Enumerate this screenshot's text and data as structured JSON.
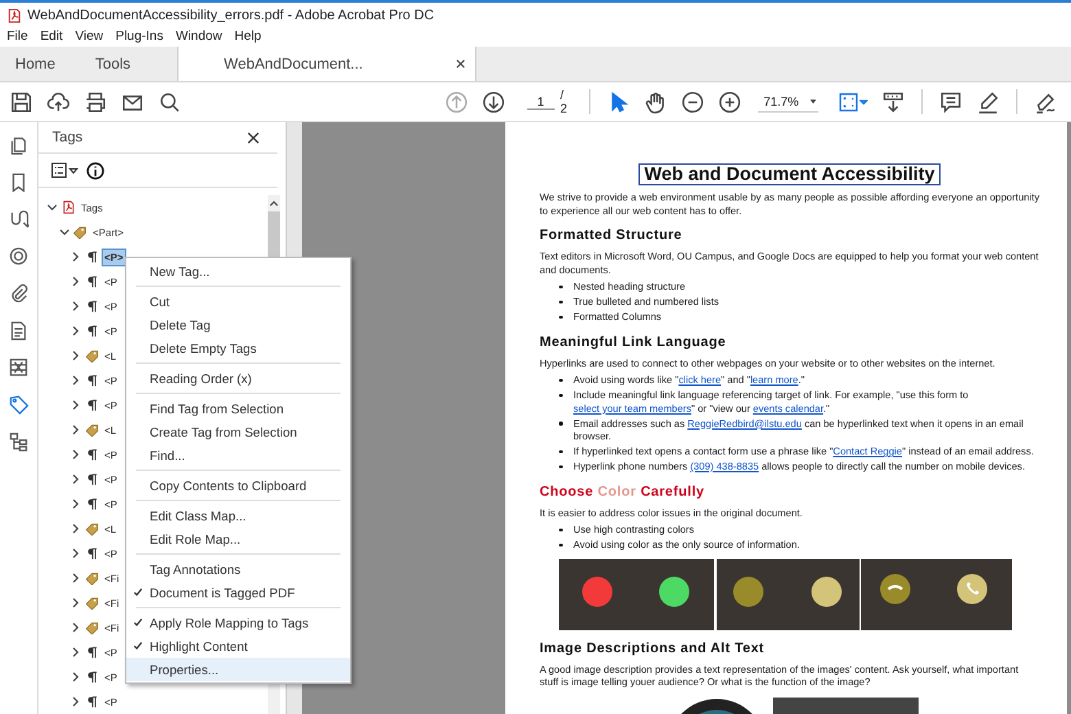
{
  "window": {
    "title": "WebAndDocumentAccessibility_errors.pdf - Adobe Acrobat Pro DC"
  },
  "menu": [
    "File",
    "Edit",
    "View",
    "Plug-Ins",
    "Window",
    "Help"
  ],
  "tabs": [
    {
      "label": "Home",
      "selected": false
    },
    {
      "label": "Tools",
      "selected": false
    },
    {
      "label": "WebAndDocument...",
      "selected": true
    }
  ],
  "toolbar": {
    "nav": [
      {
        "kind": "up",
        "disabled": true
      },
      {
        "kind": "down",
        "disabled": false
      }
    ],
    "page": "1",
    "page_total": "/ 2",
    "tools": [
      {
        "kind": "pointer",
        "selected": true
      },
      {
        "kind": "hand",
        "selected": false
      }
    ],
    "zoom": "71.7%"
  },
  "rail": [
    {
      "kind": "pages",
      "selected": false
    },
    {
      "kind": "bookmarks",
      "selected": false
    },
    {
      "kind": "hook",
      "selected": false
    },
    {
      "kind": "target",
      "selected": false
    },
    {
      "kind": "attachments",
      "selected": false
    },
    {
      "kind": "document",
      "selected": false
    },
    {
      "kind": "compare",
      "selected": false
    },
    {
      "kind": "tags",
      "selected": true
    },
    {
      "kind": "tree",
      "selected": false
    }
  ],
  "tags_panel": {
    "title": "Tags",
    "tree": [
      {
        "label": "Tags",
        "kind": "root",
        "expanded": true,
        "selected": false,
        "children": [
          {
            "label": "<Part>",
            "kind": "tag",
            "expanded": true,
            "selected": false,
            "children": [
              {
                "label": "<P>",
                "kind": "para",
                "expanded": false,
                "selected": true
              },
              {
                "label": "<P",
                "kind": "para",
                "expanded": false,
                "selected": false
              },
              {
                "label": "<P",
                "kind": "para",
                "expanded": false,
                "selected": false
              },
              {
                "label": "<P",
                "kind": "para",
                "expanded": false,
                "selected": false
              },
              {
                "label": "<L",
                "kind": "tag",
                "expanded": false,
                "selected": false
              },
              {
                "label": "<P",
                "kind": "para",
                "expanded": false,
                "selected": false
              },
              {
                "label": "<P",
                "kind": "para",
                "expanded": false,
                "selected": false
              },
              {
                "label": "<L",
                "kind": "tag",
                "expanded": false,
                "selected": false
              },
              {
                "label": "<P",
                "kind": "para",
                "expanded": false,
                "selected": false
              },
              {
                "label": "<P",
                "kind": "para",
                "expanded": false,
                "selected": false
              },
              {
                "label": "<P",
                "kind": "para",
                "expanded": false,
                "selected": false
              },
              {
                "label": "<L",
                "kind": "tag",
                "expanded": false,
                "selected": false
              },
              {
                "label": "<P",
                "kind": "para",
                "expanded": false,
                "selected": false
              },
              {
                "label": "<Fi",
                "kind": "tag",
                "expanded": false,
                "selected": false
              },
              {
                "label": "<Fi",
                "kind": "tag",
                "expanded": false,
                "selected": false
              },
              {
                "label": "<Fi",
                "kind": "tag",
                "expanded": false,
                "selected": false
              },
              {
                "label": "<P",
                "kind": "para",
                "expanded": false,
                "selected": false
              },
              {
                "label": "<P",
                "kind": "para",
                "expanded": false,
                "selected": false
              },
              {
                "label": "<P",
                "kind": "para",
                "expanded": false,
                "selected": false
              }
            ]
          }
        ]
      }
    ]
  },
  "context_menu": [
    {
      "kind": "item",
      "label": "New Tag...",
      "checked": false,
      "selected": false
    },
    {
      "kind": "separator"
    },
    {
      "kind": "item",
      "label": "Cut",
      "checked": false,
      "selected": false
    },
    {
      "kind": "item",
      "label": "Delete Tag",
      "checked": false,
      "selected": false
    },
    {
      "kind": "item",
      "label": "Delete Empty Tags",
      "checked": false,
      "selected": false
    },
    {
      "kind": "separator"
    },
    {
      "kind": "item",
      "label": "Reading Order (x)",
      "checked": false,
      "selected": false
    },
    {
      "kind": "separator"
    },
    {
      "kind": "item",
      "label": "Find Tag from Selection",
      "checked": false,
      "selected": false
    },
    {
      "kind": "item",
      "label": "Create Tag from Selection",
      "checked": false,
      "selected": false
    },
    {
      "kind": "item",
      "label": "Find...",
      "checked": false,
      "selected": false
    },
    {
      "kind": "separator"
    },
    {
      "kind": "item",
      "label": "Copy Contents to Clipboard",
      "checked": false,
      "selected": false
    },
    {
      "kind": "separator"
    },
    {
      "kind": "item",
      "label": "Edit Class Map...",
      "checked": false,
      "selected": false
    },
    {
      "kind": "item",
      "label": "Edit Role Map...",
      "checked": false,
      "selected": false
    },
    {
      "kind": "separator"
    },
    {
      "kind": "item",
      "label": "Tag Annotations",
      "checked": false,
      "selected": false
    },
    {
      "kind": "item",
      "label": "Document is Tagged PDF",
      "checked": true,
      "selected": false
    },
    {
      "kind": "separator"
    },
    {
      "kind": "item",
      "label": "Apply Role Mapping to Tags",
      "checked": true,
      "selected": false
    },
    {
      "kind": "item",
      "label": "Highlight Content",
      "checked": true,
      "selected": false
    },
    {
      "kind": "item",
      "label": "Properties...",
      "checked": false,
      "selected": true
    }
  ],
  "document": {
    "title": "Web and Document Accessibility",
    "blocks": [
      {
        "kind": "paragraph",
        "parts": [
          {
            "text": "We strive to provide a web environment usable by as many people as possible affording everyone an opportunity to experience all our web content has to offer.",
            "kind": "text"
          }
        ]
      },
      {
        "kind": "heading",
        "parts": [
          {
            "text": "Formatted Structure"
          }
        ]
      },
      {
        "kind": "paragraph",
        "parts": [
          {
            "text": "Text editors in Microsoft Word, OU Campus, and Google Docs are equipped to help you format your web content and documents.",
            "kind": "text"
          }
        ]
      },
      {
        "kind": "bullets",
        "items": [
          [
            {
              "text": "Nested heading structure",
              "kind": "text"
            }
          ],
          [
            {
              "text": "True bulleted and numbered lists",
              "kind": "text"
            }
          ],
          [
            {
              "text": "Formatted Columns",
              "kind": "text"
            }
          ]
        ]
      },
      {
        "kind": "heading",
        "parts": [
          {
            "text": "Meaningful Link Language"
          }
        ]
      },
      {
        "kind": "paragraph",
        "parts": [
          {
            "text": "Hyperlinks are used to connect to other webpages on your website or to other websites on the internet.",
            "kind": "text"
          }
        ]
      },
      {
        "kind": "bullets",
        "items": [
          [
            {
              "text": "Avoid using words like \"",
              "kind": "text"
            },
            {
              "text": "click here",
              "kind": "link"
            },
            {
              "text": "\" and \"",
              "kind": "text"
            },
            {
              "text": "learn more",
              "kind": "link"
            },
            {
              "text": ".\"",
              "kind": "text"
            }
          ],
          [
            {
              "text": "Include meaningful link language referencing target of link. For example, \"use this form to ",
              "kind": "text"
            },
            {
              "text": "select your team members",
              "kind": "link"
            },
            {
              "text": "\" or \"view our ",
              "kind": "text"
            },
            {
              "text": "events calendar",
              "kind": "link"
            },
            {
              "text": ".\"",
              "kind": "text"
            }
          ],
          [
            {
              "text": "Email addresses such as ",
              "kind": "text"
            },
            {
              "text": "ReggieRedbird@ilstu.edu",
              "kind": "link"
            },
            {
              "text": " can be hyperlinked text when it opens in an email browser.",
              "kind": "text"
            }
          ],
          [
            {
              "text": "If hyperlinked text opens a contact form use a phrase like \"",
              "kind": "text"
            },
            {
              "text": "Contact Reggie",
              "kind": "link"
            },
            {
              "text": "\" instead of an email address.",
              "kind": "text"
            }
          ],
          [
            {
              "text": "Hyperlink phone numbers ",
              "kind": "text"
            },
            {
              "text": "(309) 438-8835",
              "kind": "link"
            },
            {
              "text": " allows people to directly call the number on mobile devices.",
              "kind": "text"
            }
          ]
        ]
      },
      {
        "kind": "heading",
        "parts": [
          {
            "text": "Choose",
            "color": "#d0021b"
          },
          {
            "text": "Color",
            "color": "#e8968c"
          },
          {
            "text": "Carefully",
            "color": "#d0021b"
          }
        ]
      },
      {
        "kind": "paragraph",
        "parts": [
          {
            "text": "It is easier to address color issues in the original document.",
            "kind": "text"
          }
        ]
      },
      {
        "kind": "bullets",
        "items": [
          [
            {
              "text": "Use high contrasting colors",
              "kind": "text"
            }
          ],
          [
            {
              "text": "Avoid using color as the only source of information.",
              "kind": "text"
            }
          ]
        ]
      },
      {
        "kind": "call_screens"
      },
      {
        "kind": "heading",
        "parts": [
          {
            "text": "Image Descriptions and Alt Text"
          }
        ]
      },
      {
        "kind": "paragraph",
        "parts": [
          {
            "text": "A good image description provides a text representation of the images' content. Ask yourself, what important stuff is image telling youer audience? Or what is the function of the image?",
            "kind": "text"
          }
        ]
      },
      {
        "kind": "figures"
      }
    ]
  }
}
